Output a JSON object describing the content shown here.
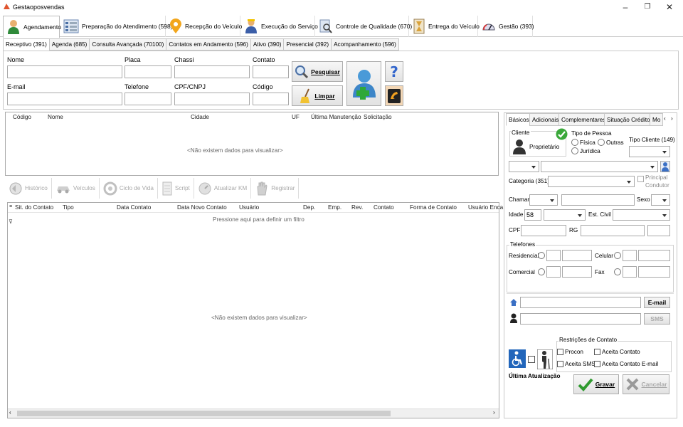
{
  "window": {
    "title": "Gestaoposvendas",
    "minimize": "–",
    "restore": "❐",
    "close": "✕"
  },
  "main_tabs": [
    {
      "label": "Agendamento",
      "icon": "person-icon"
    },
    {
      "label": "Preparação do Atendimento (598)",
      "icon": "list-icon"
    },
    {
      "label": "Recepção do Veículo",
      "icon": "map-pin-icon"
    },
    {
      "label": "Execução do Serviço",
      "icon": "mechanic-icon"
    },
    {
      "label": "Controle de Qualidade (670)",
      "icon": "inspect-icon"
    },
    {
      "label": "Entrega do Veículo",
      "icon": "hourglass-icon"
    },
    {
      "label": "Gestão (393)",
      "icon": "gauge-icon"
    }
  ],
  "sub_tabs": [
    "Receptivo (391)",
    "Agenda (685)",
    "Consulta Avançada (70100)",
    "Contatos em Andamento (596)",
    "Ativo (390)",
    "Presencial (392)",
    "Acompanhamento (596)"
  ],
  "search": {
    "nome": "Nome",
    "placa": "Placa",
    "chassi": "Chassi",
    "contato": "Contato",
    "email": "E-mail",
    "telefone": "Telefone",
    "cpf": "CPF/CNPJ",
    "codigo": "Código",
    "pesquisar": "Pesquisar",
    "limpar": "Limpar"
  },
  "grid1": {
    "columns": [
      "Código",
      "Nome",
      "Cidade",
      "UF",
      "Última Manutenção",
      "Solicitação"
    ],
    "empty": "<Não existem dados para visualizar>"
  },
  "tools": [
    "Histórico",
    "Veículos",
    "Ciclo de Vida",
    "Script",
    "Atualizar KM",
    "Registrar"
  ],
  "grid2": {
    "columns": [
      "Sit. do Contato",
      "Tipo",
      "Data Contato",
      "Data Novo Contato",
      "Usuário",
      "Dep.",
      "Emp.",
      "Rev.",
      "Contato",
      "Forma de Contato",
      "Usuário Enca"
    ],
    "filter_hint": "Pressione aqui para definir um filtro",
    "empty": "<Não existem dados para visualizar>"
  },
  "right": {
    "tabs": [
      "Básicos",
      "Adicionais",
      "Complementares",
      "Situação Crédito",
      "Mo"
    ],
    "cliente": "Cliente",
    "proprietario": "Proprietário",
    "tipo_pessoa": "Tipo de Pessoa",
    "fisica": "Física",
    "outras": "Outras",
    "juridica": "Jurídica",
    "tipo_cliente": "Tipo Cliente (149)",
    "categoria": "Categoria (351)",
    "principal_condutor_1": "Principal",
    "principal_condutor_2": "Condutor",
    "chamar": "Chamar",
    "sexo": "Sexo",
    "idade": "Idade",
    "idade_val": "58",
    "est_civil": "Est. Civil",
    "cpf": "CPF",
    "rg": "RG",
    "telefones": "Telefones",
    "residencial": "Residencial",
    "celular": "Celular",
    "comercial": "Comercial",
    "fax": "Fax",
    "email_btn": "E-mail",
    "sms_btn": "SMS",
    "restricoes": "Restrições de Contato",
    "procon": "Procon",
    "aceita_contato": "Aceita Contato",
    "aceita_sms": "Aceita SMS",
    "aceita_email": "Aceita Contato E-mail",
    "ultima_atualizacao": "Última Atualização",
    "gravar": "Gravar",
    "cancelar": "Cancelar"
  },
  "colors": {
    "accent": "#2a7fd4",
    "green": "#3aa83a",
    "orange": "#e48a00"
  }
}
